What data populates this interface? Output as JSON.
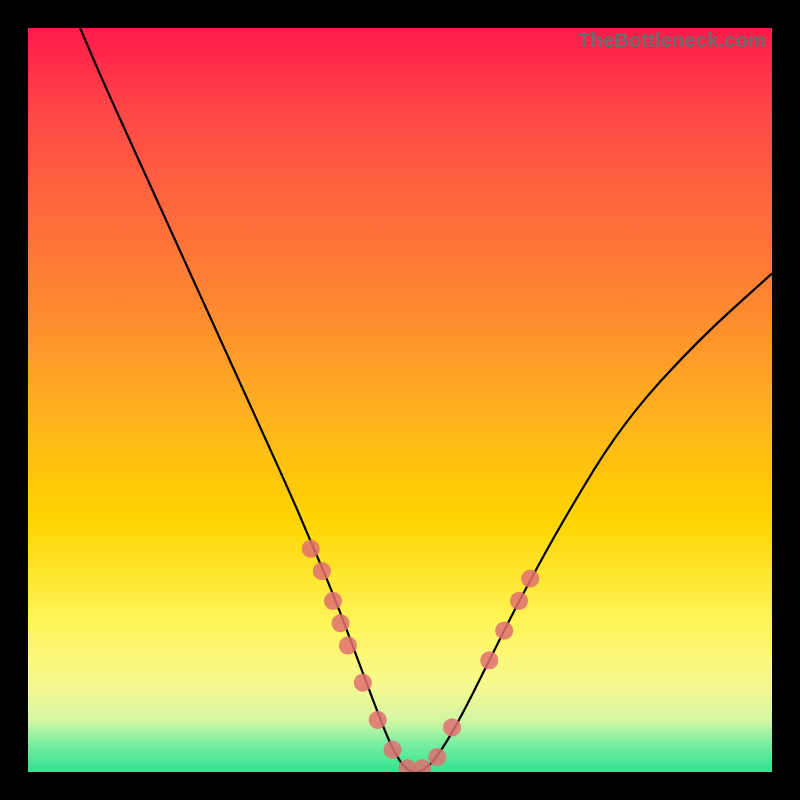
{
  "watermark": "TheBottleneck.com",
  "chart_data": {
    "type": "line",
    "title": "",
    "xlabel": "",
    "ylabel": "",
    "xlim": [
      0,
      100
    ],
    "ylim": [
      0,
      100
    ],
    "series": [
      {
        "name": "bottleneck-curve",
        "x": [
          7,
          10,
          15,
          20,
          25,
          30,
          35,
          38,
          41,
          44,
          47,
          49,
          51,
          53,
          55,
          58,
          62,
          66,
          72,
          80,
          90,
          100
        ],
        "values": [
          100,
          93,
          82,
          71,
          60,
          49,
          38,
          31,
          24,
          16,
          8,
          3,
          0,
          0,
          2,
          7,
          15,
          23,
          34,
          47,
          58,
          67
        ]
      }
    ],
    "markers": {
      "name": "uncertainty-dots",
      "color": "#e07070",
      "points": [
        {
          "x": 38,
          "y": 30
        },
        {
          "x": 39.5,
          "y": 27
        },
        {
          "x": 41,
          "y": 23
        },
        {
          "x": 42,
          "y": 20
        },
        {
          "x": 43,
          "y": 17
        },
        {
          "x": 45,
          "y": 12
        },
        {
          "x": 47,
          "y": 7
        },
        {
          "x": 49,
          "y": 3
        },
        {
          "x": 51,
          "y": 0.5
        },
        {
          "x": 53,
          "y": 0.5
        },
        {
          "x": 55,
          "y": 2
        },
        {
          "x": 57,
          "y": 6
        },
        {
          "x": 62,
          "y": 15
        },
        {
          "x": 64,
          "y": 19
        },
        {
          "x": 66,
          "y": 23
        },
        {
          "x": 67.5,
          "y": 26
        }
      ]
    },
    "background": "rainbow-gradient",
    "grid": false
  }
}
